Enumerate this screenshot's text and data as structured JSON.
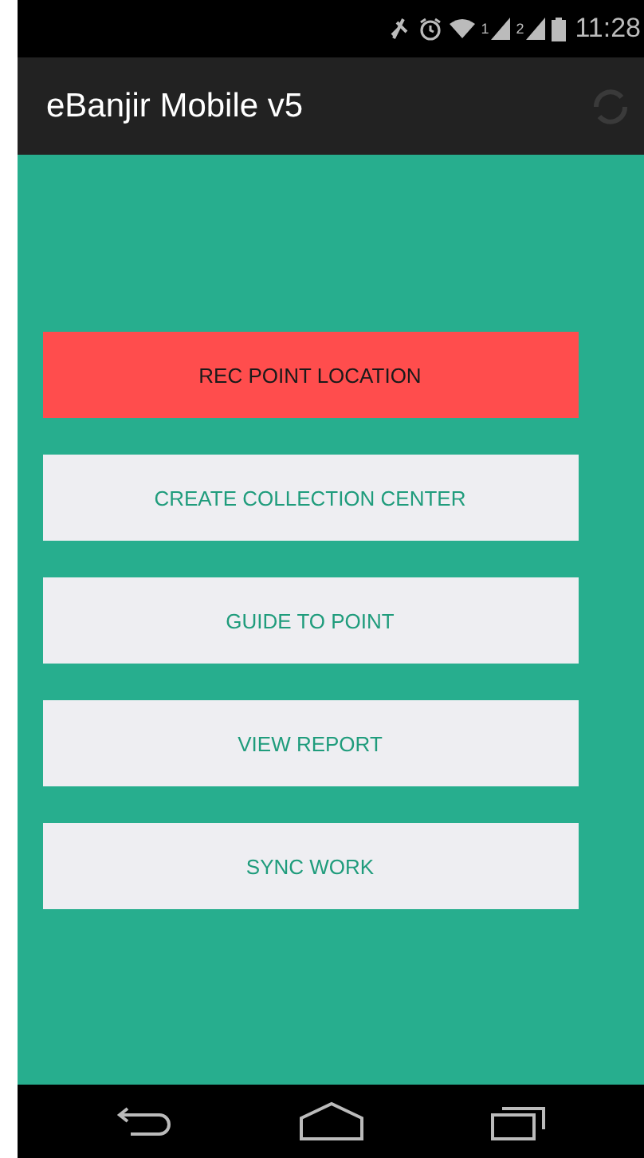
{
  "status_bar": {
    "sim_labels": [
      "1",
      "2"
    ],
    "time": "11:28"
  },
  "action_bar": {
    "title": "eBanjir Mobile v5"
  },
  "buttons": [
    {
      "label": "REC POINT LOCATION",
      "selected": true
    },
    {
      "label": "CREATE COLLECTION CENTER",
      "selected": false
    },
    {
      "label": "GUIDE TO POINT",
      "selected": false
    },
    {
      "label": "VIEW REPORT",
      "selected": false
    },
    {
      "label": "SYNC WORK",
      "selected": false
    }
  ]
}
